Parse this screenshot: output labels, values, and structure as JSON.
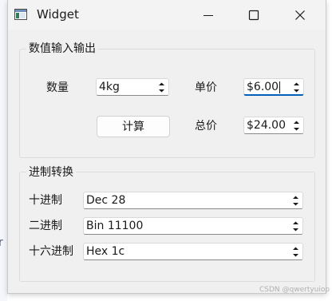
{
  "window": {
    "title": "Widget"
  },
  "numeric_group": {
    "title": "数值输入输出",
    "quantity_label": "数量",
    "quantity_value": "4kg",
    "unit_price_label": "单价",
    "unit_price_value": "$6.00",
    "calculate_label": "计算",
    "total_label": "总价",
    "total_value": "$24.00"
  },
  "base_group": {
    "title": "进制转换",
    "decimal_label": "十进制",
    "decimal_value": "Dec 28",
    "binary_label": "二进制",
    "binary_value": "Bin 11100",
    "hex_label": "十六进制",
    "hex_value": "Hex 1c"
  },
  "background": {
    "glyph": "r"
  },
  "watermark": "CSDN @qwertyuiop"
}
